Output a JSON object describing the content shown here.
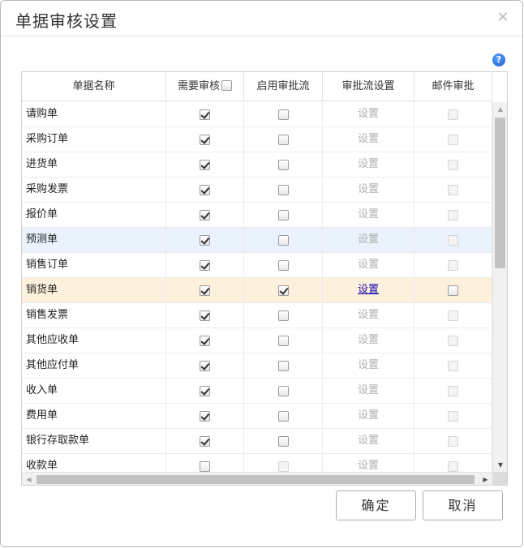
{
  "dialog": {
    "title": "单据审核设置",
    "close_glyph": "×",
    "help_glyph": "?"
  },
  "grid": {
    "columns": [
      "单据名称",
      "需要审核",
      "启用审批流",
      "审批流设置",
      "邮件审批"
    ],
    "header_checkbox_checked": false,
    "rows": [
      {
        "name": "请购单",
        "audit": true,
        "flow": false,
        "setting": "设置",
        "flow_enabled": false,
        "mail": false
      },
      {
        "name": "采购订单",
        "audit": true,
        "flow": false,
        "setting": "设置",
        "flow_enabled": false,
        "mail": false
      },
      {
        "name": "进货单",
        "audit": true,
        "flow": false,
        "setting": "设置",
        "flow_enabled": false,
        "mail": false
      },
      {
        "name": "采购发票",
        "audit": true,
        "flow": false,
        "setting": "设置",
        "flow_enabled": false,
        "mail": false
      },
      {
        "name": "报价单",
        "audit": true,
        "flow": false,
        "setting": "设置",
        "flow_enabled": false,
        "mail": false
      },
      {
        "name": "预测单",
        "audit": true,
        "flow": false,
        "setting": "设置",
        "flow_enabled": false,
        "mail": false
      },
      {
        "name": "销售订单",
        "audit": true,
        "flow": false,
        "setting": "设置",
        "flow_enabled": false,
        "mail": false
      },
      {
        "name": "销货单",
        "audit": true,
        "flow": true,
        "setting": "设置",
        "flow_enabled": true,
        "mail": false
      },
      {
        "name": "销售发票",
        "audit": true,
        "flow": false,
        "setting": "设置",
        "flow_enabled": false,
        "mail": false
      },
      {
        "name": "其他应收单",
        "audit": true,
        "flow": false,
        "setting": "设置",
        "flow_enabled": false,
        "mail": false
      },
      {
        "name": "其他应付单",
        "audit": true,
        "flow": false,
        "setting": "设置",
        "flow_enabled": false,
        "mail": false
      },
      {
        "name": "收入单",
        "audit": true,
        "flow": false,
        "setting": "设置",
        "flow_enabled": false,
        "mail": false
      },
      {
        "name": "费用单",
        "audit": true,
        "flow": false,
        "setting": "设置",
        "flow_enabled": false,
        "mail": false
      },
      {
        "name": "银行存取款单",
        "audit": true,
        "flow": false,
        "setting": "设置",
        "flow_enabled": false,
        "mail": false
      },
      {
        "name": "收款单",
        "audit": false,
        "flow": false,
        "setting": "设置",
        "flow_enabled": false,
        "mail": false
      }
    ],
    "hover_row": 5,
    "selected_row": 7
  },
  "buttons": {
    "ok_label": "确定",
    "cancel_label": "取消"
  },
  "colors": {
    "hover_row": "#eaf2fb",
    "selected_row": "#fdf0dc",
    "link": "#1a0dab",
    "help_icon": "#1d5fcf"
  }
}
